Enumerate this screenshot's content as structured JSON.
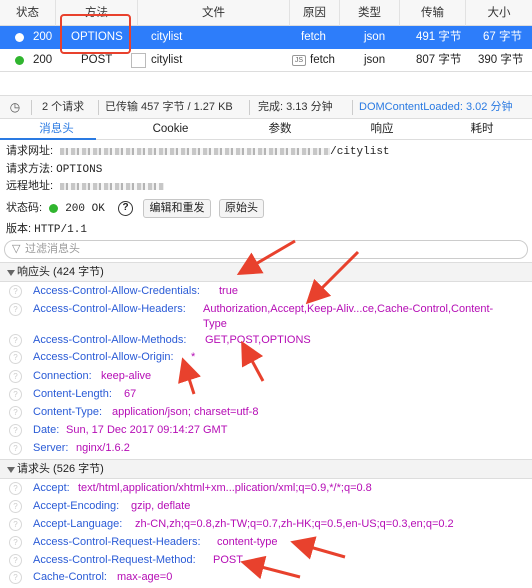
{
  "columns": [
    "状态",
    "方法",
    "文件",
    "原因",
    "类型",
    "传输",
    "大小"
  ],
  "requests": [
    {
      "status": "200",
      "method": "OPTIONS",
      "file": "citylist",
      "cause": "fetch",
      "type": "json",
      "transferred": "491 字节",
      "size": "67 字节"
    },
    {
      "status": "200",
      "method": "POST",
      "file": "citylist",
      "cause": "fetch",
      "type": "json",
      "transferred": "807 字节",
      "size": "390 字节"
    }
  ],
  "summary": {
    "requests": "2 个请求",
    "transferred": "已传输 457 字节 / 1.27 KB",
    "finish": "完成: 3.13 分钟",
    "dcl": "DOMContentLoaded: 3.02 分钟"
  },
  "tabs": [
    "消息头",
    "Cookie",
    "参数",
    "响应",
    "耗时"
  ],
  "general": {
    "url_label": "请求网址:",
    "url_value": "/citylist",
    "method_label": "请求方法:",
    "method_value": "OPTIONS",
    "remote_label": "远程地址:",
    "status_label": "状态码:",
    "status_value": "200 OK",
    "edit_resend": "编辑和重发",
    "raw_headers": "原始头",
    "version_label": "版本:",
    "version_value": "HTTP/1.1"
  },
  "filter_placeholder": "过滤消息头",
  "response_section": "响应头 (424 字节)",
  "response_headers": [
    {
      "name": "Access-Control-Allow-Credentials:",
      "value": "true"
    },
    {
      "name": "Access-Control-Allow-Headers:",
      "value": "Authorization,Accept,Keep-Aliv...ce,Cache-Control,Content-",
      "value2": "Type"
    },
    {
      "name": "Access-Control-Allow-Methods:",
      "value": "GET,POST,OPTIONS"
    },
    {
      "name": "Access-Control-Allow-Origin:",
      "value": "*"
    },
    {
      "name": "Connection:",
      "value": "keep-alive"
    },
    {
      "name": "Content-Length:",
      "value": "67"
    },
    {
      "name": "Content-Type:",
      "value": "application/json; charset=utf-8"
    },
    {
      "name": "Date:",
      "value": "Sun, 17 Dec 2017 09:14:27 GMT"
    },
    {
      "name": "Server:",
      "value": "nginx/1.6.2"
    }
  ],
  "request_section": "请求头 (526 字节)",
  "request_headers": [
    {
      "name": "Accept:",
      "value": "text/html,application/xhtml+xm...plication/xml;q=0.9,*/*;q=0.8"
    },
    {
      "name": "Accept-Encoding:",
      "value": "gzip, deflate"
    },
    {
      "name": "Accept-Language:",
      "value": "zh-CN,zh;q=0.8,zh-TW;q=0.7,zh-HK;q=0.5,en-US;q=0.3,en;q=0.2"
    },
    {
      "name": "Access-Control-Request-Headers:",
      "value": "content-type"
    },
    {
      "name": "Access-Control-Request-Method:",
      "value": "POST"
    },
    {
      "name": "Cache-Control:",
      "value": "max-age=0"
    }
  ],
  "colors": {
    "accent": "#2d7dfa",
    "header_name": "#2a5bd6",
    "header_value": "#b50db5",
    "annotation": "#e8412d",
    "status_ok": "#30b52f"
  }
}
